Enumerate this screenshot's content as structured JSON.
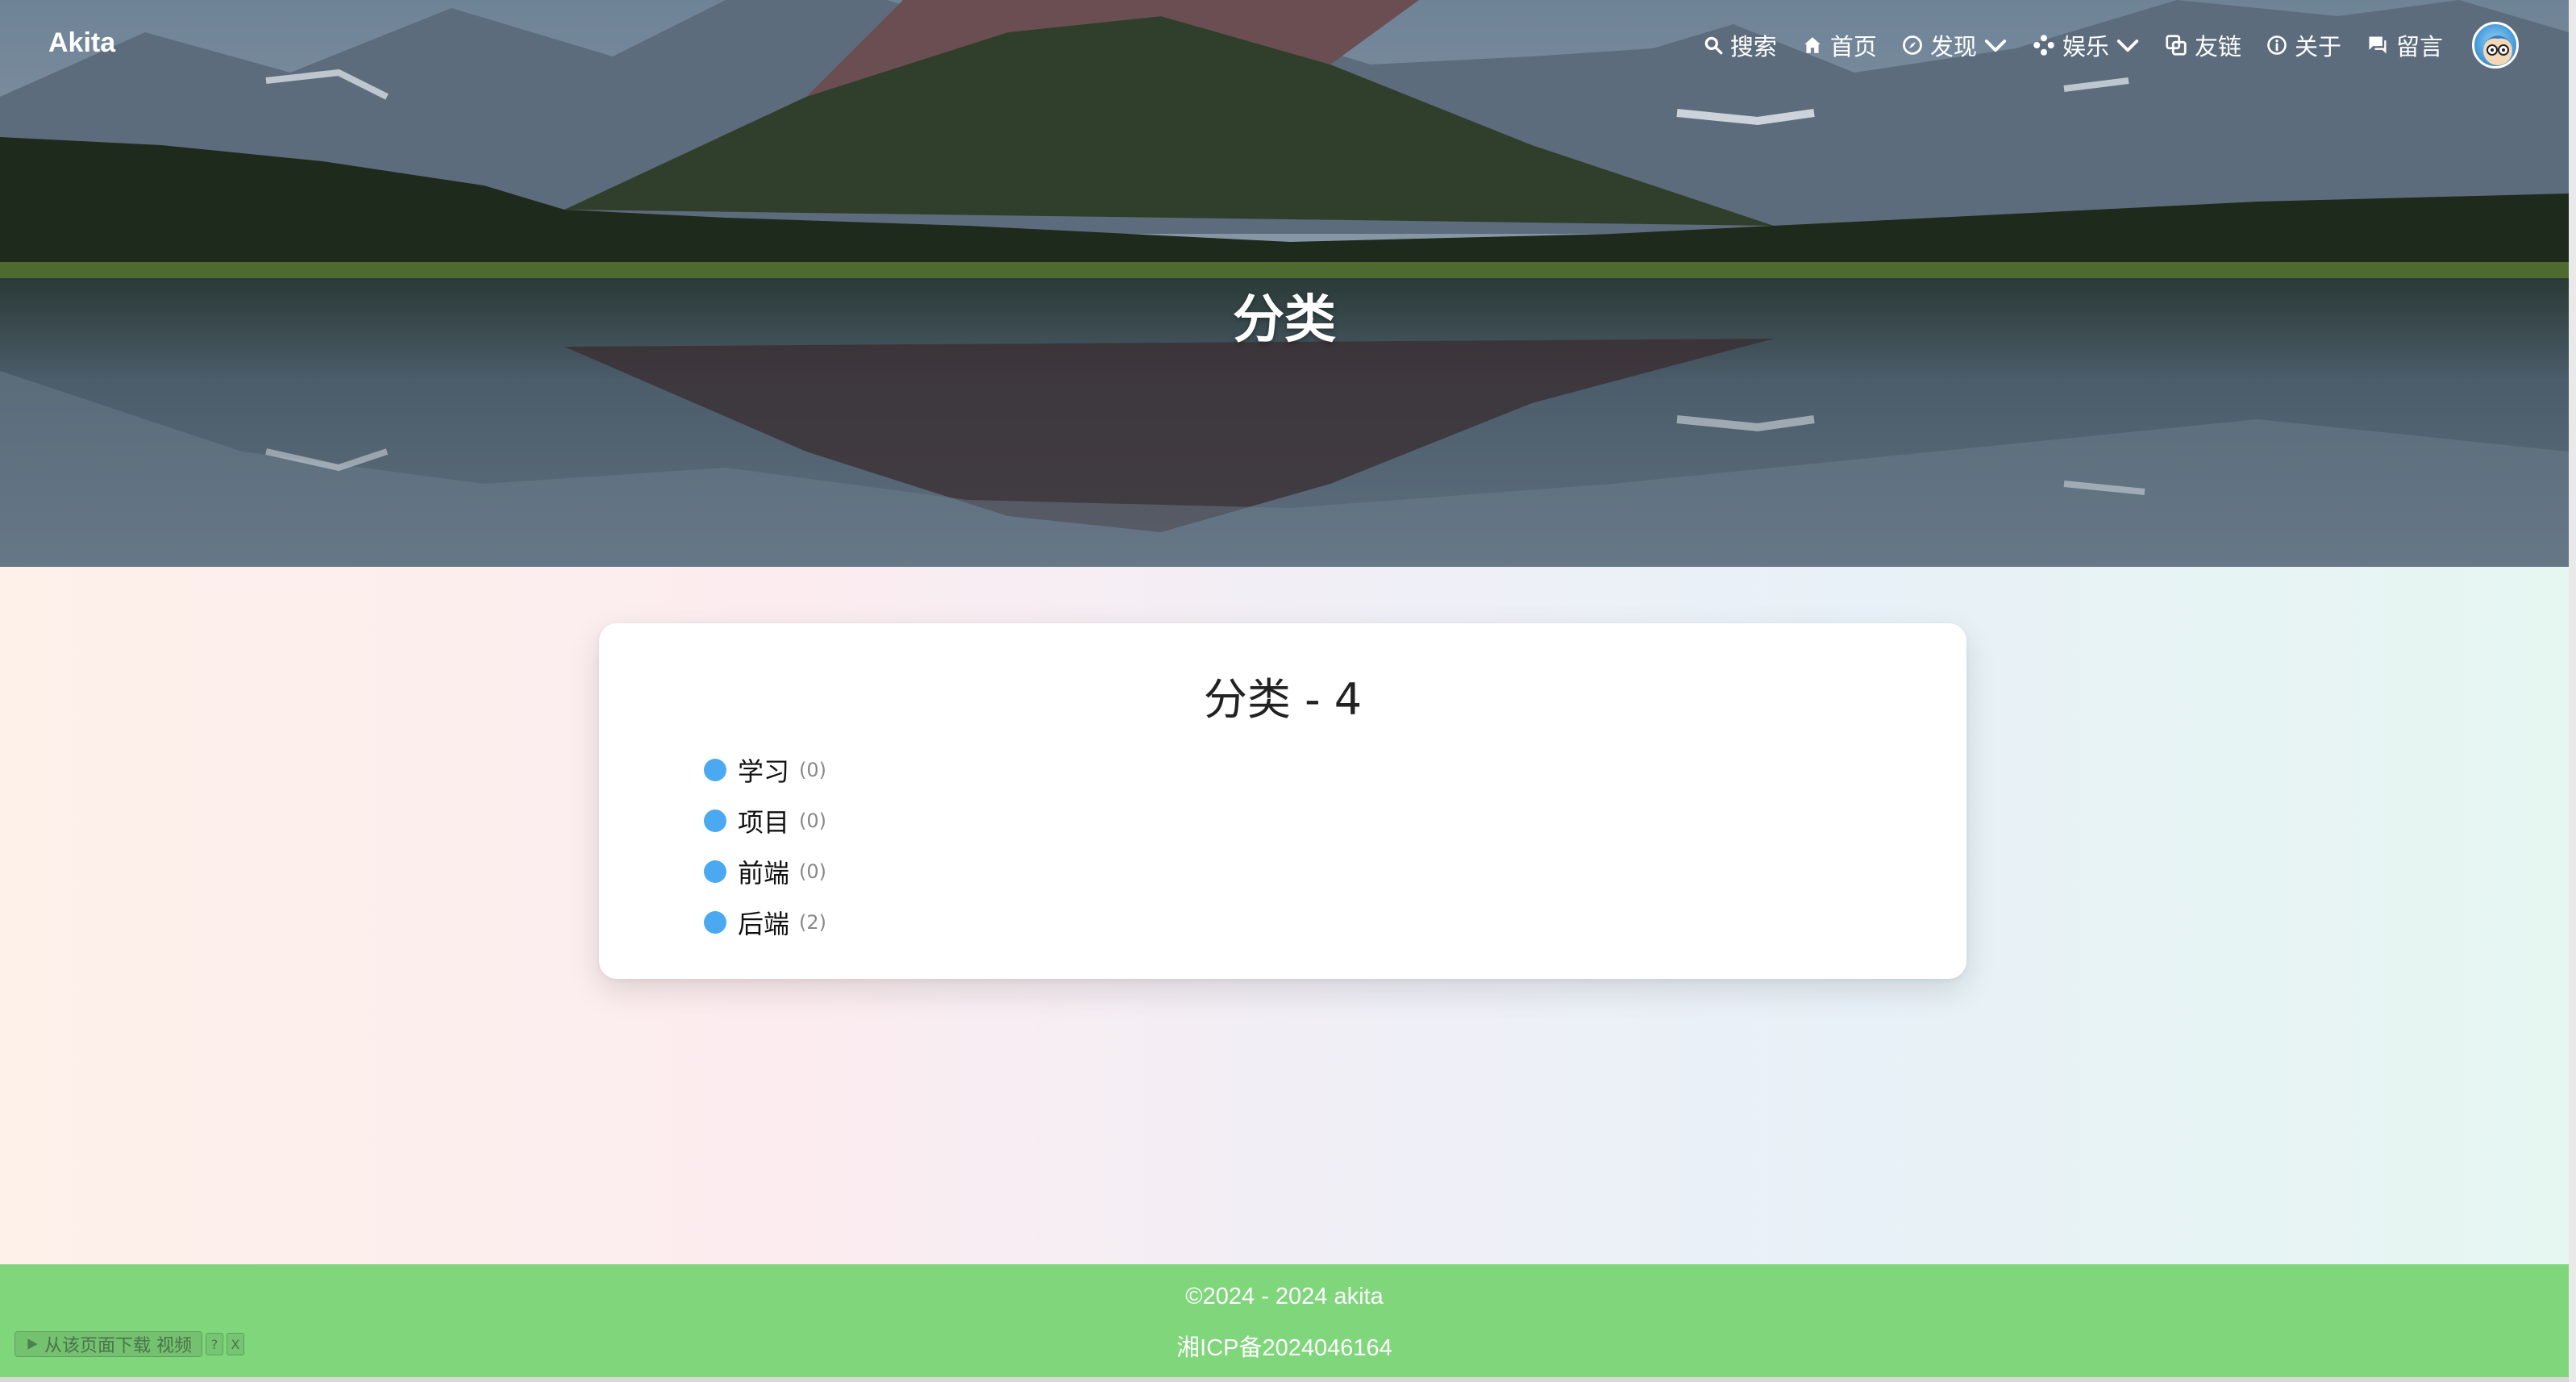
{
  "site": {
    "brand": "Akita"
  },
  "nav": {
    "items": [
      {
        "label": "搜索",
        "icon": "search-icon"
      },
      {
        "label": "首页",
        "icon": "home-icon"
      },
      {
        "label": "发现",
        "icon": "compass-icon",
        "dropdown": true
      },
      {
        "label": "娱乐",
        "icon": "games-icon",
        "dropdown": true
      },
      {
        "label": "友链",
        "icon": "link-icon"
      },
      {
        "label": "关于",
        "icon": "info-icon"
      },
      {
        "label": "留言",
        "icon": "message-icon"
      }
    ]
  },
  "hero": {
    "title": "分类"
  },
  "card": {
    "title": "分类 - 4",
    "categories": [
      {
        "name": "学习",
        "count": "(0)"
      },
      {
        "name": "项目",
        "count": "(0)"
      },
      {
        "name": "前端",
        "count": "(0)"
      },
      {
        "name": "后端",
        "count": "(2)"
      }
    ]
  },
  "footer": {
    "copyright": "©2024 - 2024 akita",
    "icp": "湘ICP备2024046164"
  },
  "download_widget": {
    "label": "从该页面下载 视频",
    "help": "?",
    "close": "X"
  },
  "colors": {
    "accent_dot": "#4aa9f0",
    "footer_bg": "#7fd67b",
    "card_bg": "#ffffff"
  }
}
